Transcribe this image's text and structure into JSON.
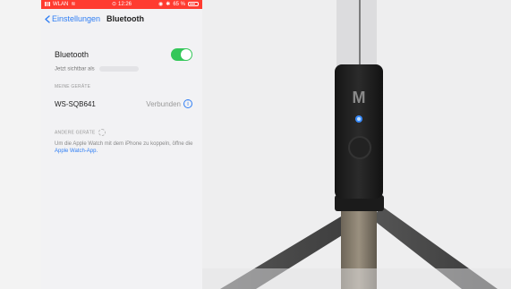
{
  "status_bar": {
    "carrier": "WLAN",
    "time": "12:26",
    "battery": "65 %",
    "background": "#ff3b30"
  },
  "nav": {
    "back_label": "Einstellungen",
    "title": "Bluetooth"
  },
  "bluetooth": {
    "label": "Bluetooth",
    "toggle_on": true,
    "visible_label": "Jetzt sichtbar als"
  },
  "sections": {
    "my_devices": "MEINE GERÄTE",
    "other_devices": "ANDERE GERÄTE"
  },
  "device": {
    "name": "WS-SQB641",
    "status": "Verbunden"
  },
  "help": {
    "text": "Um die Apple Watch mit dem iPhone zu koppeln, öffne die",
    "link": "Apple Watch-App."
  },
  "colors": {
    "accent": "#2f7ef4",
    "toggle": "#34c759"
  },
  "product_photo": {
    "logo_text": "M"
  }
}
